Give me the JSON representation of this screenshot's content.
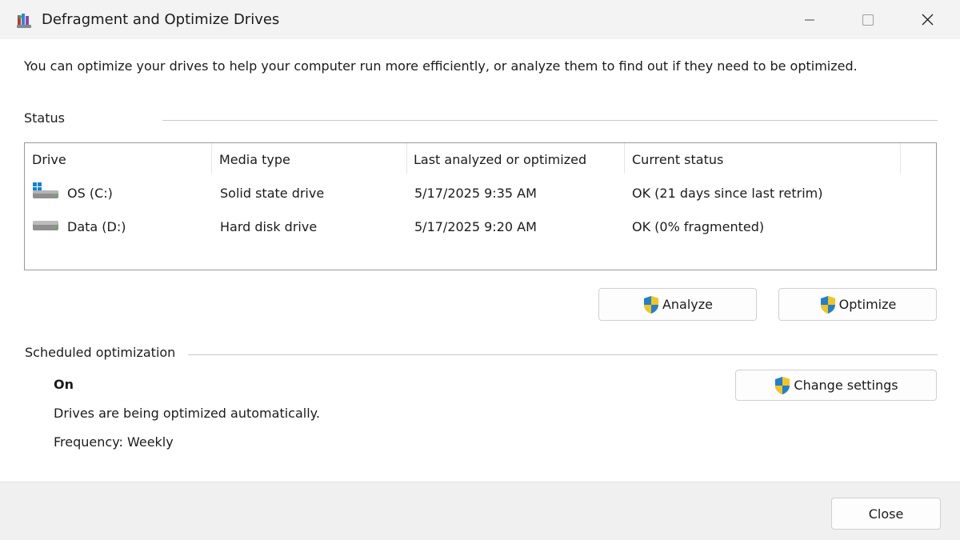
{
  "window": {
    "title": "Defragment and Optimize Drives",
    "app_icon": "defrag-app-icon",
    "controls": [
      "minimize-icon",
      "maximize-icon",
      "close-icon"
    ]
  },
  "intro_text": "You can optimize your drives to help your computer run more efficiently, or analyze them to find out if they need to be optimized.",
  "status": {
    "label": "Status",
    "columns": [
      "Drive",
      "Media type",
      "Last analyzed or optimized",
      "Current status"
    ],
    "drives": [
      {
        "icon": "windows-drive-icon",
        "name": "OS (C:)",
        "media_type": "Solid state drive",
        "last_run": "5/17/2025 9:35 AM",
        "current_status": "OK (21 days since last retrim)"
      },
      {
        "icon": "hard-drive-icon",
        "name": "Data (D:)",
        "media_type": "Hard disk drive",
        "last_run": "5/17/2025 9:20 AM",
        "current_status": "OK (0% fragmented)"
      }
    ]
  },
  "actions": {
    "analyze_label": "Analyze",
    "optimize_label": "Optimize",
    "shield_icon": "uac-shield-icon"
  },
  "scheduled": {
    "label": "Scheduled optimization",
    "state": "On",
    "description": "Drives are being optimized automatically.",
    "frequency": "Frequency: Weekly",
    "change_settings_label": "Change settings"
  },
  "footer": {
    "close_label": "Close"
  },
  "colors": {
    "window_bg": "#f0f0f0",
    "content_bg": "#ffffff",
    "list_border": "#9a9a9a",
    "shield_blue": "#1e7fd6",
    "shield_yellow": "#f5c518"
  }
}
